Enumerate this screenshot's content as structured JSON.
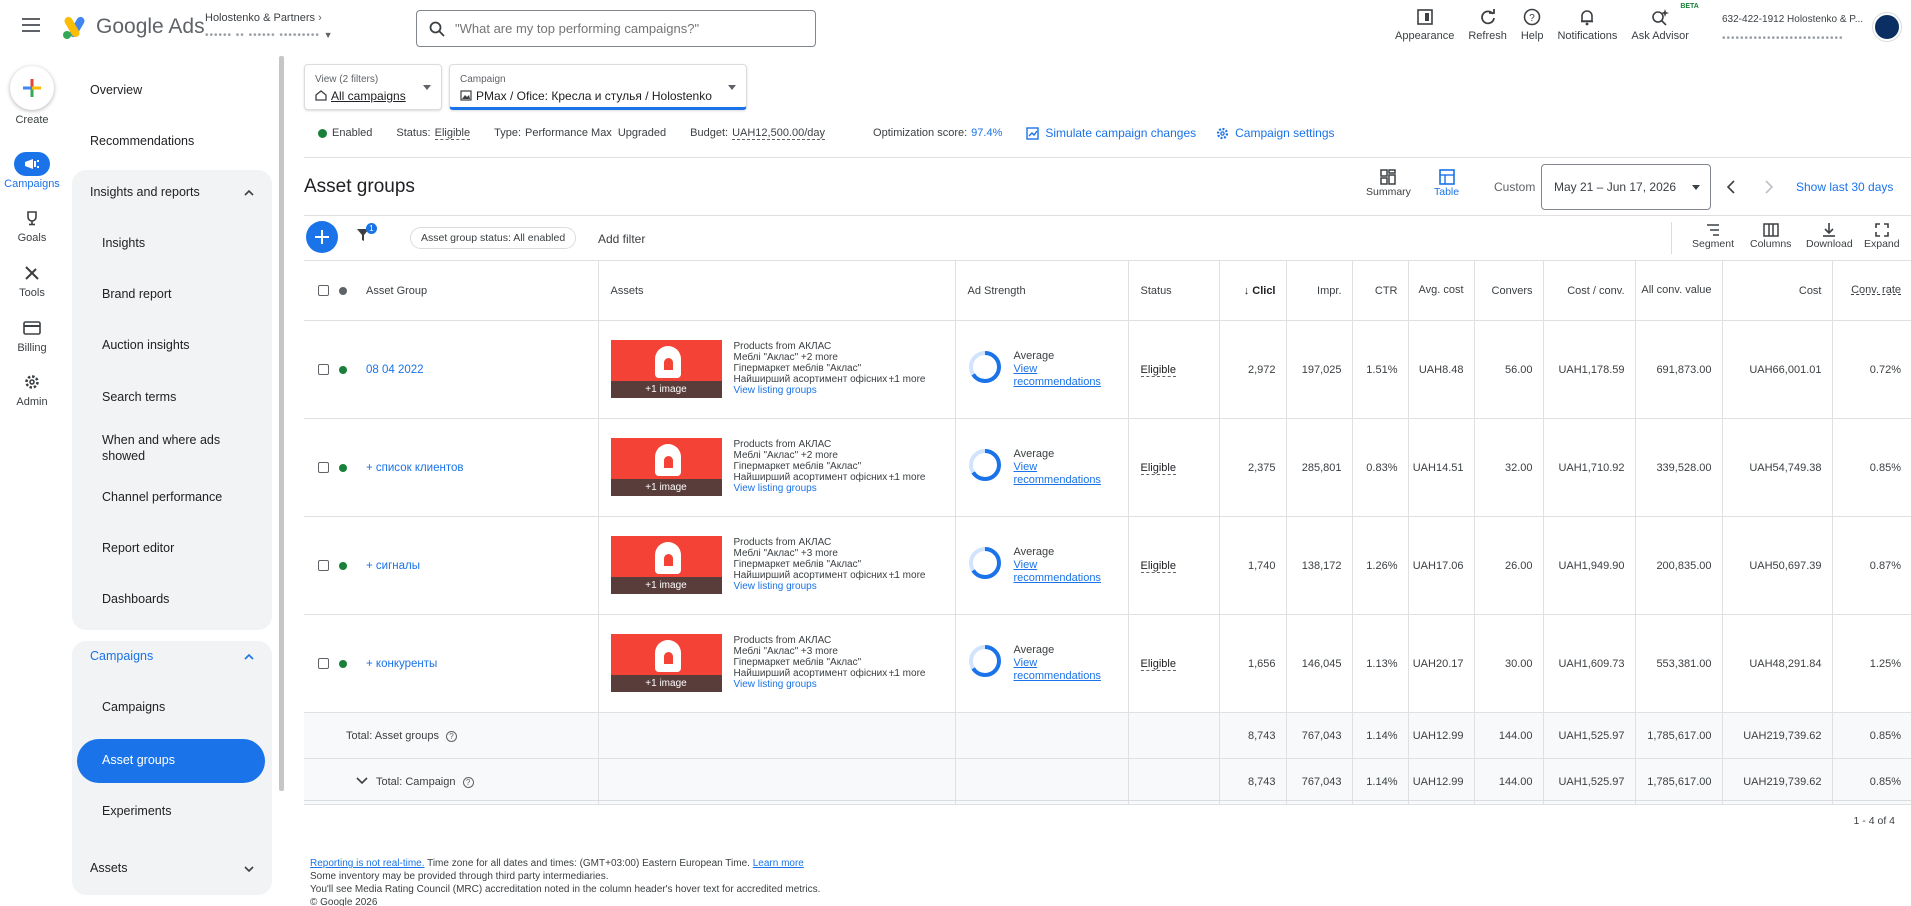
{
  "topbar": {
    "app_name": "Google Ads",
    "account_name": "Holostenko & Partners",
    "account_sub": "•••••• •• ••••••  •••••••••",
    "search_placeholder": "\"What are my top performing campaigns?\"",
    "actions": [
      {
        "label": "Appearance",
        "icon": "appearance-icon"
      },
      {
        "label": "Refresh",
        "icon": "refresh-icon"
      },
      {
        "label": "Help",
        "icon": "help-icon"
      },
      {
        "label": "Notifications",
        "icon": "bell-icon"
      },
      {
        "label": "Ask Advisor",
        "icon": "sparkle-icon",
        "badge": "BETA"
      }
    ],
    "customer": "632-422-1912 Holostenko & P...",
    "customer_sub": "•••••••••••••••••••••••••••"
  },
  "rail": [
    {
      "label": "Create"
    },
    {
      "label": "Campaigns"
    },
    {
      "label": "Goals"
    },
    {
      "label": "Tools"
    },
    {
      "label": "Billing"
    },
    {
      "label": "Admin"
    }
  ],
  "sidenav": {
    "overview": "Overview",
    "recommendations": "Recommendations",
    "insights_group": "Insights and reports",
    "insights": "Insights",
    "brand_report": "Brand report",
    "auction_insights": "Auction insights",
    "search_terms": "Search terms",
    "when_where": "When and where ads showed",
    "channel_performance": "Channel performance",
    "report_editor": "Report editor",
    "dashboards": "Dashboards",
    "campaigns_group": "Campaigns",
    "campaigns": "Campaigns",
    "asset_groups": "Asset groups",
    "experiments": "Experiments",
    "assets": "Assets"
  },
  "filters": {
    "view_caption": "View (2 filters)",
    "view_value": "All campaigns",
    "campaign_caption": "Campaign",
    "campaign_value": "PMax / Ofice: Кресла и стулья / Holostenko"
  },
  "status": {
    "enabled": "Enabled",
    "status_label": "Status:",
    "status_value": "Eligible",
    "type_label": "Type:",
    "type_value": "Performance Max",
    "upgraded": "Upgraded",
    "budget_label": "Budget:",
    "budget_value": "UAH12,500.00/day",
    "opt_label": "Optimization score:",
    "opt_value": "97.4%",
    "simulate": "Simulate campaign changes",
    "settings": "Campaign settings"
  },
  "page": {
    "title": "Asset groups",
    "summary": "Summary",
    "table": "Table",
    "custom": "Custom",
    "date_range": "May 21 – Jun 17, 2026",
    "show_last": "Show last 30 days"
  },
  "toolbar": {
    "filter_count": "1",
    "chip": "Asset group status: All enabled",
    "add_filter": "Add filter",
    "segment": "Segment",
    "columns": "Columns",
    "download": "Download",
    "expand": "Expand"
  },
  "table": {
    "headers": {
      "asset_group": "Asset Group",
      "assets": "Assets",
      "ad_strength": "Ad Strength",
      "status": "Status",
      "clicks": "↓ Clicl",
      "impr": "Impr.",
      "ctr": "CTR",
      "avg_cost": "Avg. cost",
      "conversions": "Convers",
      "cost_conv": "Cost / conv.",
      "all_conv_value": "All conv. value",
      "cost": "Cost",
      "conv_rate": "Conv. rate"
    },
    "rows": [
      {
        "name": "08 04 2022",
        "image_label": "+1 image",
        "lines": [
          "Products from АКЛАС",
          "Меблі \"Аклас\" +2 more",
          "Гіпермаркет меблів \"Аклас\"",
          "Найширший асортимент офісних ..."
        ],
        "more": "+1 more",
        "listing": "View listing groups",
        "strength": "Average",
        "view_rec_1": "View",
        "view_rec_2": "recommendations",
        "status": "Eligible",
        "clicks": "2,972",
        "impr": "197,025",
        "ctr": "1.51%",
        "avg_cost": "UAH8.48",
        "conversions": "56.00",
        "cost_conv": "UAH1,178.59",
        "all_conv_value": "691,873.00",
        "cost": "UAH66,001.01",
        "conv_rate": "0.72%"
      },
      {
        "name": "+ список клиентов",
        "image_label": "+1 image",
        "lines": [
          "Products from АКЛАС",
          "Меблі \"Аклас\" +2 more",
          "Гіпермаркет меблів \"Аклас\"",
          "Найширший асортимент офісних ..."
        ],
        "more": "+1 more",
        "listing": "View listing groups",
        "strength": "Average",
        "view_rec_1": "View",
        "view_rec_2": "recommendations",
        "status": "Eligible",
        "clicks": "2,375",
        "impr": "285,801",
        "ctr": "0.83%",
        "avg_cost": "UAH14.51",
        "conversions": "32.00",
        "cost_conv": "UAH1,710.92",
        "all_conv_value": "339,528.00",
        "cost": "UAH54,749.38",
        "conv_rate": "0.85%"
      },
      {
        "name": "+ сигналы",
        "image_label": "+1 image",
        "lines": [
          "Products from АКЛАС",
          "Меблі \"Аклас\" +3 more",
          "Гіпермаркет меблів \"Аклас\"",
          "Найширший асортимент офісних ..."
        ],
        "more": "+1 more",
        "listing": "View listing groups",
        "strength": "Average",
        "view_rec_1": "View",
        "view_rec_2": "recommendations",
        "status": "Eligible",
        "clicks": "1,740",
        "impr": "138,172",
        "ctr": "1.26%",
        "avg_cost": "UAH17.06",
        "conversions": "26.00",
        "cost_conv": "UAH1,949.90",
        "all_conv_value": "200,835.00",
        "cost": "UAH50,697.39",
        "conv_rate": "0.87%"
      },
      {
        "name": "+ конкуренты",
        "image_label": "+1 image",
        "lines": [
          "Products from АКЛАС",
          "Меблі \"Аклас\" +3 more",
          "Гіпермаркет меблів \"Аклас\"",
          "Найширший асортимент офісних ..."
        ],
        "more": "+1 more",
        "listing": "View listing groups",
        "strength": "Average",
        "view_rec_1": "View",
        "view_rec_2": "recommendations",
        "status": "Eligible",
        "clicks": "1,656",
        "impr": "146,045",
        "ctr": "1.13%",
        "avg_cost": "UAH20.17",
        "conversions": "30.00",
        "cost_conv": "UAH1,609.73",
        "all_conv_value": "553,381.00",
        "cost": "UAH48,291.84",
        "conv_rate": "1.25%"
      }
    ],
    "totals": [
      {
        "label": "Total: Asset groups",
        "clicks": "8,743",
        "impr": "767,043",
        "ctr": "1.14%",
        "avg_cost": "UAH12.99",
        "conversions": "144.00",
        "cost_conv": "UAH1,525.97",
        "all_conv_value": "1,785,617.00",
        "cost": "UAH219,739.62",
        "conv_rate": "0.85%"
      },
      {
        "label": "Total: Campaign",
        "clicks": "8,743",
        "impr": "767,043",
        "ctr": "1.14%",
        "avg_cost": "UAH12.99",
        "conversions": "144.00",
        "cost_conv": "UAH1,525.97",
        "all_conv_value": "1,785,617.00",
        "cost": "UAH219,739.62",
        "conv_rate": "0.85%"
      }
    ],
    "pager": "1 - 4 of 4"
  },
  "footer": {
    "reporting_link": "Reporting is not real-time.",
    "timezone": " Time zone for all dates and times: (GMT+03:00) Eastern European Time. ",
    "learn_more": "Learn more",
    "line2": "Some inventory may be provided through third party intermediaries.",
    "line3": "You'll see Media Rating Council (MRC) accreditation noted in the column header's hover text for accredited metrics.",
    "line4": "© Google 2026"
  },
  "colors": {
    "accent": "#1a73e8",
    "enabled": "#188038",
    "thumb": "#f44336"
  }
}
